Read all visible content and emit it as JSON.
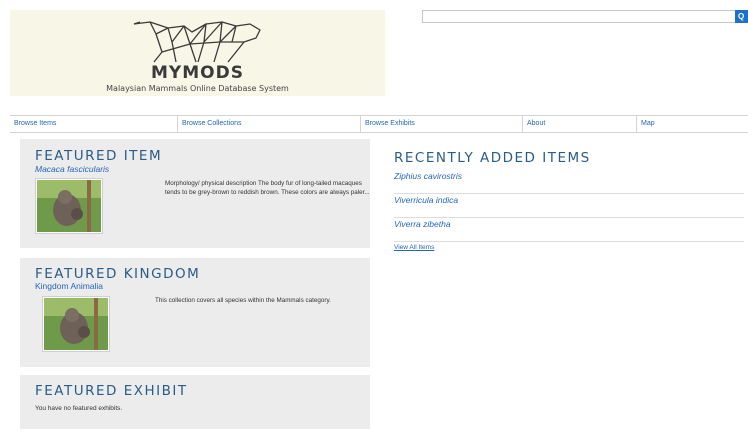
{
  "site": {
    "name": "MYMODS",
    "subtitle": "Malaysian Mammals Online Database System"
  },
  "search": {
    "placeholder": "",
    "button_label": "Q"
  },
  "nav": {
    "items": [
      {
        "label": "Browse Items"
      },
      {
        "label": "Browse Collections"
      },
      {
        "label": "Browse Exhibits"
      },
      {
        "label": "About"
      },
      {
        "label": "Map"
      }
    ]
  },
  "featured_item": {
    "heading": "FEATURED ITEM",
    "name": "Macaca fascicularis",
    "description": "Morphology/ physical description The body fur of long-tailed macaques tends to be grey-brown to reddish brown. These colors are always paler..."
  },
  "featured_kingdom": {
    "heading": "FEATURED KINGDOM",
    "name": "Kingdom Animalia",
    "description": "This collection covers all species within the Mammals category."
  },
  "featured_exhibit": {
    "heading": "FEATURED EXHIBIT",
    "message": "You have no featured exhibits."
  },
  "recent": {
    "heading": "RECENTLY ADDED ITEMS",
    "items": [
      {
        "name": "Ziphius cavirostris"
      },
      {
        "name": "Viverricula indica"
      },
      {
        "name": "Viverra zibetha"
      }
    ],
    "view_all_label": "View All Items"
  },
  "colors": {
    "heading": "#2a5c88",
    "link": "#2566b8",
    "panel_bg": "#ececec",
    "logo_bg": "#f8f6e6",
    "search_button": "#1a73c9"
  }
}
